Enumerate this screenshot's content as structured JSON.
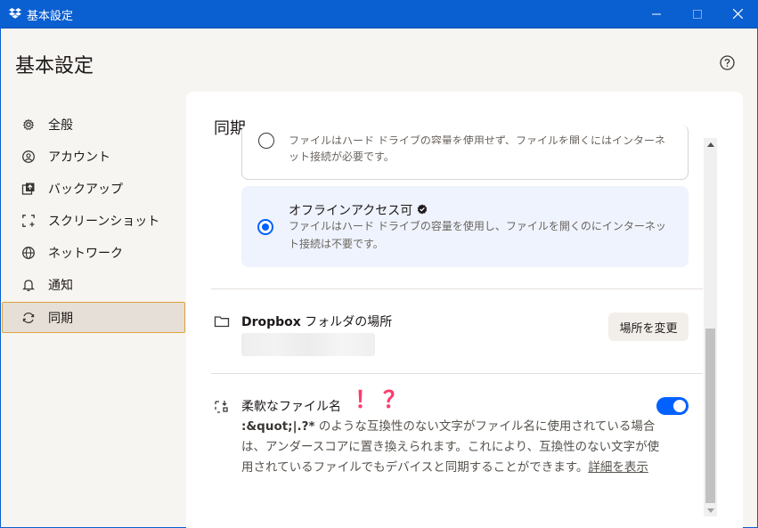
{
  "window": {
    "title": "基本設定"
  },
  "page": {
    "title": "基本設定"
  },
  "sidebar": {
    "items": [
      {
        "label": "全般",
        "icon": "gear-icon"
      },
      {
        "label": "アカウント",
        "icon": "account-icon"
      },
      {
        "label": "バックアップ",
        "icon": "backup-icon"
      },
      {
        "label": "スクリーンショット",
        "icon": "screenshot-icon"
      },
      {
        "label": "ネットワーク",
        "icon": "globe-icon"
      },
      {
        "label": "通知",
        "icon": "bell-icon"
      },
      {
        "label": "同期",
        "icon": "sync-icon"
      }
    ],
    "active": "同期"
  },
  "sync": {
    "title": "同期",
    "option_online": {
      "desc_line1": "ファイルはハード ドライブの容量を使用せず、ファイルを開くにはインターネ",
      "desc_line2": "ット接続が必要です。"
    },
    "option_offline": {
      "title": "オフラインアクセス可",
      "desc": "ファイルはハード ドライブの容量を使用し、ファイルを開くのにインターネット接続は不要です。"
    },
    "folder": {
      "label_bold": "Dropbox",
      "label_rest": " フォルダの場所",
      "change_button": "場所を変更"
    },
    "flexible_names": {
      "title": "柔軟なファイル名",
      "exclaim": "！",
      "question": "？",
      "desc_code": ":&quot;|.?*",
      "desc_text": " のような互換性のない文字がファイル名に使用されている場合は、アンダースコアに置き換えられます。これにより、互換性のない文字が使用されているファイルでもデバイスと同期することができます。",
      "link_line1": "詳",
      "link_line2": "細を表示",
      "enabled": true
    }
  },
  "colors": {
    "accent": "#0061fe",
    "titlebar": "#0a5fd1",
    "active_outline": "#e0a33a"
  }
}
